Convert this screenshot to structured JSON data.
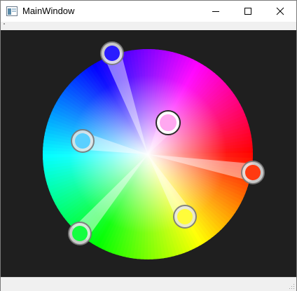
{
  "window": {
    "title": "MainWindow",
    "controls": [
      "minimize",
      "maximize",
      "close"
    ]
  },
  "wheel": {
    "handles": [
      {
        "name": "handle-purple",
        "color": "#ffa8f0",
        "role": "center-selection"
      },
      {
        "name": "handle-blue",
        "color": "#2a1cff"
      },
      {
        "name": "handle-light-blue",
        "color": "#5ad0ff"
      },
      {
        "name": "handle-green",
        "color": "#14ff40"
      },
      {
        "name": "handle-yellow",
        "color": "#fffc3a"
      },
      {
        "name": "handle-red",
        "color": "#ff3a10"
      }
    ]
  },
  "icons": {
    "app": "window-app-icon",
    "minimize": "minimize-icon",
    "maximize": "maximize-icon",
    "close": "close-icon",
    "grip": "resize-grip-icon"
  }
}
